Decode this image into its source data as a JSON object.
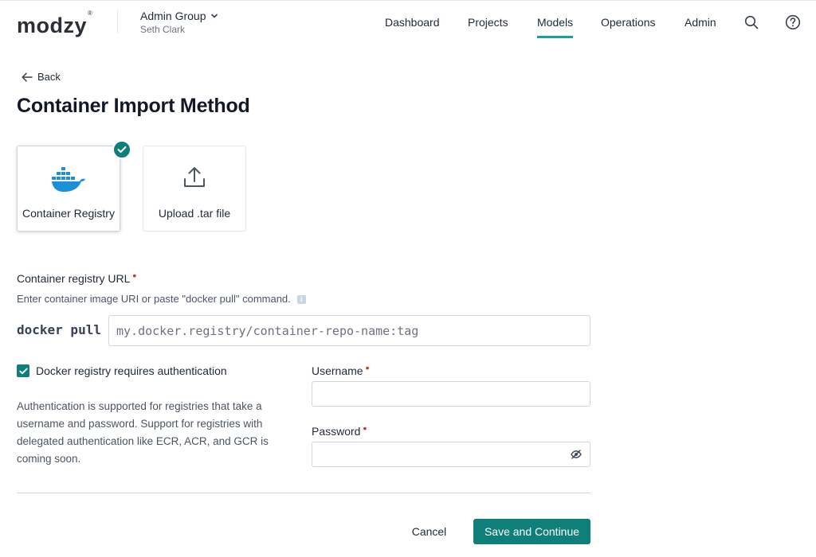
{
  "header": {
    "logo": "modzy",
    "logo_mark": "®",
    "org": {
      "name": "Admin Group",
      "user": "Seth Clark"
    },
    "nav": [
      {
        "label": "Dashboard",
        "active": false
      },
      {
        "label": "Projects",
        "active": false
      },
      {
        "label": "Models",
        "active": true
      },
      {
        "label": "Operations",
        "active": false
      },
      {
        "label": "Admin",
        "active": false
      }
    ],
    "icons": {
      "search": "search-icon",
      "help": "help-icon"
    },
    "accent_color": "#14a39a"
  },
  "page": {
    "back_label": "Back",
    "title": "Container Import Method",
    "methods": [
      {
        "label": "Container Registry",
        "icon": "docker-icon",
        "selected": true
      },
      {
        "label": "Upload .tar file",
        "icon": "upload-icon",
        "selected": false
      }
    ]
  },
  "form": {
    "registry_url": {
      "label": "Container registry URL",
      "required": "•",
      "help": "Enter container image URI or paste \"docker pull\" command.",
      "prefix": "docker pull",
      "placeholder": "my.docker.registry/container-repo-name:tag",
      "value": ""
    },
    "auth_checkbox": {
      "label": "Docker registry requires authentication",
      "checked": true
    },
    "auth_note": "Authentication is supported for registries that take a username and password. Support for registries with delegated authentication like ECR, ACR, and GCR is coming soon.",
    "username": {
      "label": "Username",
      "required": "•",
      "value": ""
    },
    "password": {
      "label": "Password",
      "required": "•",
      "value": ""
    }
  },
  "actions": {
    "cancel": "Cancel",
    "submit": "Save and Continue",
    "primary_color": "#0f7f7a"
  }
}
